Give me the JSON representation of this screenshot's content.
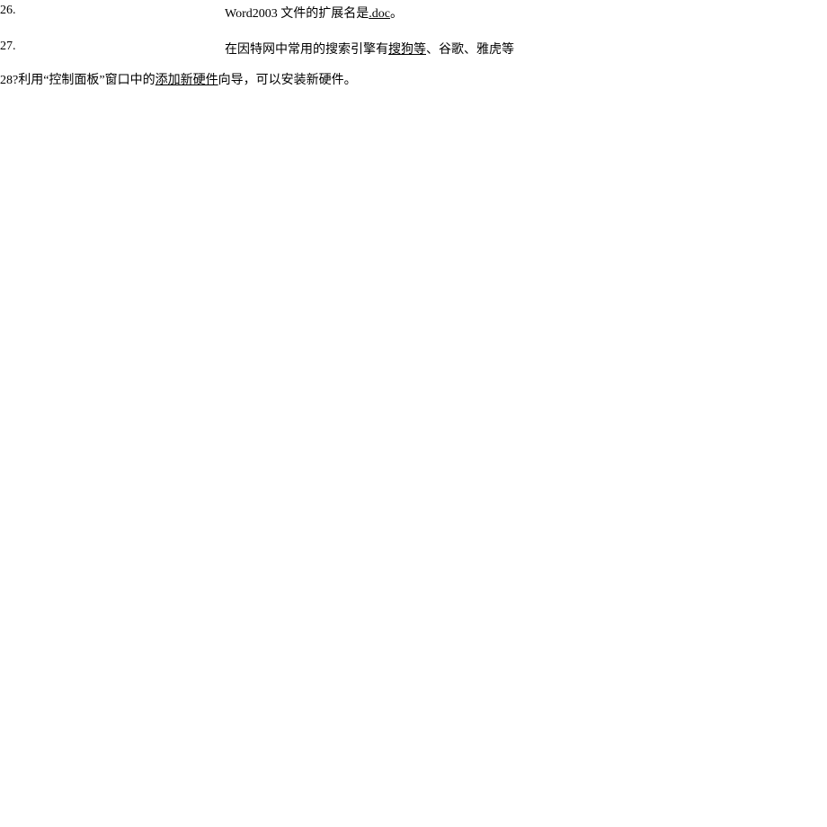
{
  "lines": {
    "l26": {
      "number": "26.",
      "text_before": "Word2003 文件的扩展名是",
      "underlined": ".doc",
      "text_after": "。"
    },
    "l27": {
      "number": "27.",
      "text_before": "在因特网中常用的搜索引擎有",
      "underlined": "搜狗等",
      "text_after": "、谷歌、雅虎等"
    },
    "l28": {
      "prefix": "28?利用“控制面板”窗口中的",
      "underlined": "添加新硬件",
      "suffix": "向导，可以安装新硬件。"
    }
  }
}
